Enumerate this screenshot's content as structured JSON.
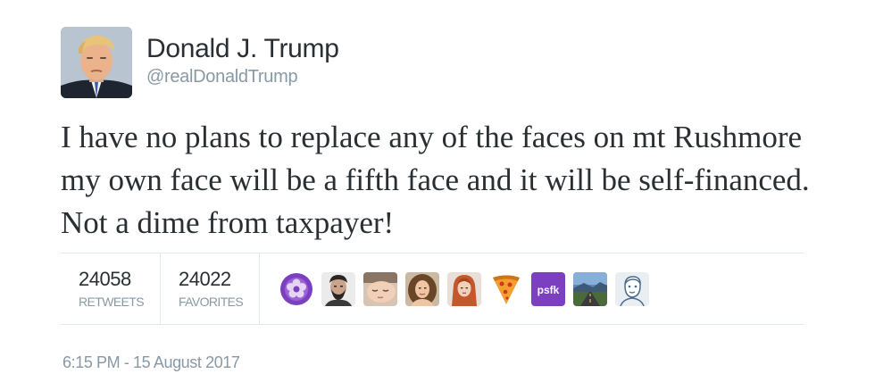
{
  "user": {
    "display_name": "Donald J. Trump",
    "handle": "@realDonaldTrump",
    "avatar_icon": "profile-photo"
  },
  "tweet": {
    "text": "I have no plans to replace any of the faces on mt Rushmore my own face will be a fifth face and it will be self-financed. Not a dime from taxpayer!"
  },
  "stats": {
    "retweets": {
      "count": "24058",
      "label": "RETWEETS"
    },
    "favorites": {
      "count": "24022",
      "label": "FAVORITES"
    }
  },
  "favoriters": [
    {
      "icon": "purple-flower-avatar"
    },
    {
      "icon": "bearded-man-avatar"
    },
    {
      "icon": "sleeping-face-avatar"
    },
    {
      "icon": "woman-curly-hair-avatar"
    },
    {
      "icon": "woman-red-hair-avatar"
    },
    {
      "icon": "pizza-slice-avatar"
    },
    {
      "icon": "psfk-logo-avatar",
      "text": "psfk"
    },
    {
      "icon": "road-landscape-avatar"
    },
    {
      "icon": "sketch-man-avatar"
    }
  ],
  "timestamp": "6:15 PM - 15 August 2017",
  "colors": {
    "text": "#292f33",
    "secondary": "#8899a6",
    "border": "#e1e8ed",
    "psfk": "#7b3fbf"
  }
}
